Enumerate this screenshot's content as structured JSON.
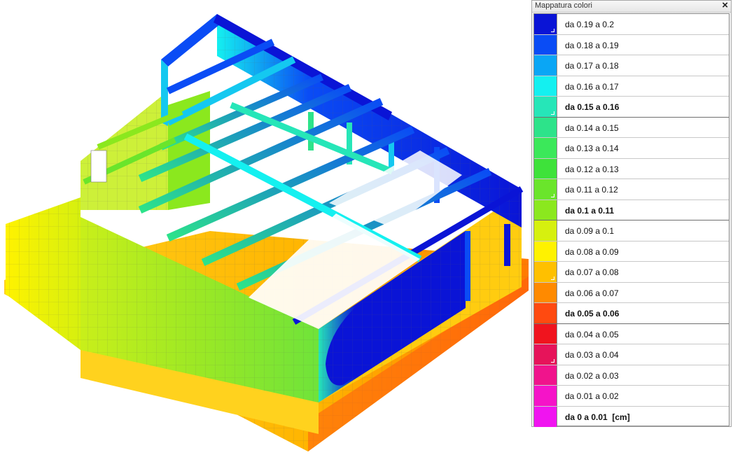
{
  "legend": {
    "title": "Mappatura colori",
    "close_glyph": "×",
    "items": [
      {
        "label": "da 0.19 a 0.2",
        "color": "#0a14d6",
        "major": false
      },
      {
        "label": "da 0.18 a 0.19",
        "color": "#0a4cf5",
        "major": false
      },
      {
        "label": "da 0.17 a 0.18",
        "color": "#0aa6f5",
        "major": false
      },
      {
        "label": "da 0.16 a 0.17",
        "color": "#14f0f0",
        "major": false
      },
      {
        "label": "da 0.15 a 0.16",
        "color": "#26e6b8",
        "major": true
      },
      {
        "label": "da 0.14 a 0.15",
        "color": "#2de38a",
        "major": false
      },
      {
        "label": "da 0.13 a 0.14",
        "color": "#3be85a",
        "major": false
      },
      {
        "label": "da 0.12 a 0.13",
        "color": "#3ee23a",
        "major": false
      },
      {
        "label": "da 0.11 a 0.12",
        "color": "#6ae52b",
        "major": false
      },
      {
        "label": "da 0.1 a 0.11",
        "color": "#8be81e",
        "major": true
      },
      {
        "label": "da 0.09 a 0.1",
        "color": "#d6f00f",
        "major": false
      },
      {
        "label": "da 0.08 a 0.09",
        "color": "#fff200",
        "major": false
      },
      {
        "label": "da 0.07 a 0.08",
        "color": "#ffc000",
        "major": false
      },
      {
        "label": "da 0.06 a 0.07",
        "color": "#ff8a00",
        "major": false
      },
      {
        "label": "da 0.05 a 0.06",
        "color": "#ff4a10",
        "major": true
      },
      {
        "label": "da 0.04 a 0.05",
        "color": "#f0141e",
        "major": false
      },
      {
        "label": "da 0.03 a 0.04",
        "color": "#e6145a",
        "major": false
      },
      {
        "label": "da 0.02 a 0.03",
        "color": "#f0148c",
        "major": false
      },
      {
        "label": "da 0.01 a 0.02",
        "color": "#f514c8",
        "major": false
      },
      {
        "label": "da 0 a 0.01  [cm]",
        "color": "#f014f0",
        "major": true
      }
    ]
  }
}
